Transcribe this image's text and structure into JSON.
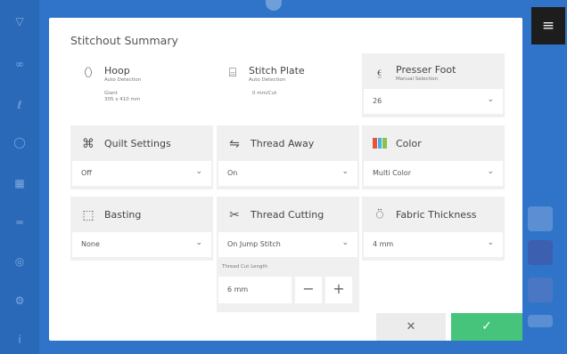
{
  "dialog": {
    "title": "Stitchout Summary",
    "cancel_label": "✕",
    "confirm_label": "✓"
  },
  "hoop": {
    "title": "Hoop",
    "subtitle": "Auto Detection",
    "size_name": "Giant",
    "size_dims": "305 x 410 mm"
  },
  "stitch_plate": {
    "title": "Stitch Plate",
    "subtitle": "Auto Detection",
    "detail": "0 mm/Cut"
  },
  "presser_foot": {
    "title": "Presser Foot",
    "subtitle": "Manual Selection",
    "value": "26"
  },
  "quilt_settings": {
    "title": "Quilt Settings",
    "value": "Off"
  },
  "thread_away": {
    "title": "Thread Away",
    "value": "On"
  },
  "color": {
    "title": "Color",
    "value": "Multi Color",
    "swatches": [
      "#e8533f",
      "#3cb4e4",
      "#8bc34a"
    ]
  },
  "basting": {
    "title": "Basting",
    "value": "None"
  },
  "thread_cutting": {
    "title": "Thread Cutting",
    "value": "On Jump Stitch",
    "cut_length_label": "Thread Cut Length",
    "cut_length_value": "6 mm",
    "minus": "−",
    "plus": "+"
  },
  "fabric_thickness": {
    "title": "Fabric Thickness",
    "value": "4 mm"
  },
  "background": {
    "menu_icon": "≡"
  }
}
